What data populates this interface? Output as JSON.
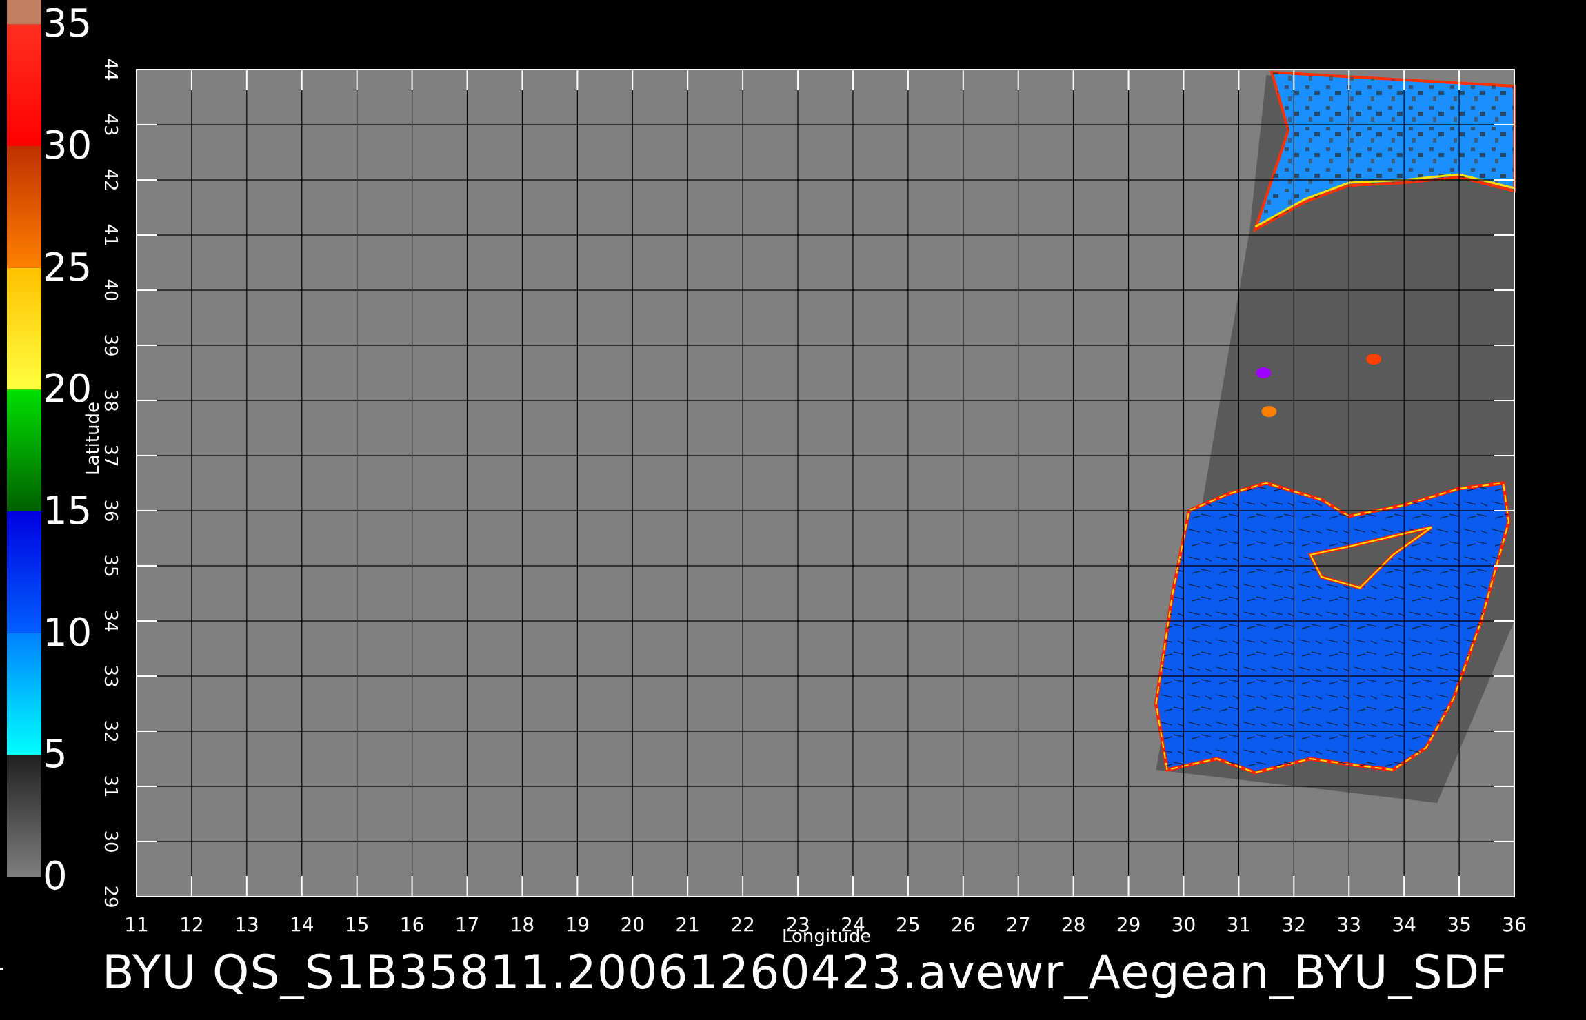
{
  "colorbar": {
    "labels": [
      "35",
      "30",
      "25",
      "20",
      "15",
      "10",
      "5",
      "0"
    ],
    "bands": [
      {
        "from": 0,
        "to": 5,
        "colors": [
          "#7e7e7e",
          "#202020"
        ]
      },
      {
        "from": 5,
        "to": 10,
        "colors": [
          "#00ffff",
          "#0080ff"
        ]
      },
      {
        "from": 10,
        "to": 15,
        "colors": [
          "#0060ff",
          "#0000e0"
        ]
      },
      {
        "from": 15,
        "to": 20,
        "colors": [
          "#006000",
          "#00e000"
        ]
      },
      {
        "from": 20,
        "to": 25,
        "colors": [
          "#ffff40",
          "#ffc000"
        ]
      },
      {
        "from": 25,
        "to": 30,
        "colors": [
          "#ff8000",
          "#c03000"
        ]
      },
      {
        "from": 30,
        "to": 35,
        "colors": [
          "#ff0000",
          "#ff3020"
        ]
      },
      {
        "from": 35,
        "to": 36,
        "colors": [
          "#c08060",
          "#c08060"
        ]
      }
    ]
  },
  "map": {
    "lon_range": [
      11,
      36
    ],
    "lat_range": [
      29,
      44
    ],
    "lon_ticks": [
      "11",
      "12",
      "13",
      "14",
      "15",
      "16",
      "17",
      "18",
      "19",
      "20",
      "21",
      "22",
      "23",
      "24",
      "25",
      "26",
      "27",
      "28",
      "29",
      "30",
      "31",
      "32",
      "33",
      "34",
      "35",
      "36"
    ],
    "lat_ticks": [
      "29",
      "30",
      "31",
      "32",
      "33",
      "34",
      "35",
      "36",
      "37",
      "38",
      "39",
      "40",
      "41",
      "42",
      "43",
      "44"
    ],
    "xlabel": "Longitude",
    "ylabel": "Latitude",
    "background_color": "#808080",
    "swath_color": "#5a5a5a",
    "grid_color": "#000000"
  },
  "footer": {
    "text": "BYU  QS_S1B35811.20061260423.avewr_Aegean_BYU_SDF"
  }
}
